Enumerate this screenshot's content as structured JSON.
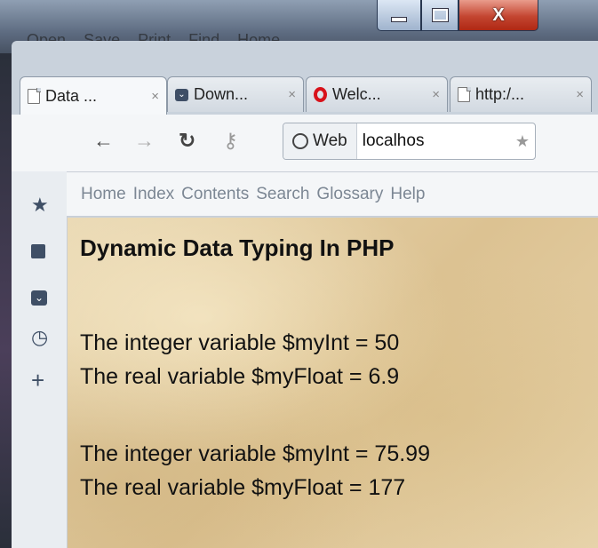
{
  "window": {
    "controls": {
      "minimize": "",
      "maximize": "",
      "close": "X"
    },
    "background_menu": [
      "Open",
      "Save",
      "Print",
      "Find",
      "Home"
    ]
  },
  "browser": {
    "tabs": [
      {
        "icon": "page-icon",
        "title": "Data ...",
        "close": "×",
        "active": true
      },
      {
        "icon": "pocket-icon",
        "title": "Down...",
        "close": "×",
        "active": false
      },
      {
        "icon": "opera-icon",
        "title": "Welc...",
        "close": "×",
        "active": false
      },
      {
        "icon": "page-icon",
        "title": "http:/...",
        "close": "×",
        "active": false
      }
    ],
    "nav": {
      "back": "←",
      "forward": "→",
      "reload": "↻",
      "key": "⚷"
    },
    "address": {
      "scope_label": "Web",
      "url": "localhos",
      "bookmark_star": "★"
    },
    "bookmarks_bar": [
      "Home",
      "Index",
      "Contents",
      "Search",
      "Glossary",
      "Help"
    ],
    "sidebar_icons": [
      "star-icon",
      "notes-icon",
      "pocket-icon",
      "history-icon",
      "add-icon"
    ]
  },
  "page": {
    "heading": "Dynamic Data Typing In PHP",
    "lines": [
      "The integer variable $myInt = 50",
      "The real variable $myFloat = 6.9",
      "The integer variable $myInt = 75.99",
      "The real variable $myFloat = 177"
    ]
  }
}
